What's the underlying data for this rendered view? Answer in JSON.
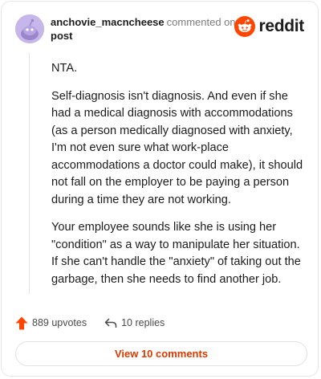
{
  "header": {
    "username": "anchovie_macncheese",
    "action": "commented on",
    "post_label": "post",
    "brand": "reddit"
  },
  "comment": {
    "paragraphs": [
      "NTA.",
      "Self-diagnosis isn't diagnosis. And even if she had a medical diagnosis with accommodations (as a person medically diagnosed with anxiety, I'm not even sure what work-place accommodations a doctor could make), it should not fall on the employer to be paying a person during a time they are not working.",
      "Your employee sounds like she is using her \"condition\" as a way to manipulate her situation. If she can't handle the \"anxiety\" of taking out the garbage, then she needs to find another job."
    ]
  },
  "footer": {
    "upvotes": "889 upvotes",
    "replies": "10 replies",
    "view_label": "View 10 comments"
  },
  "colors": {
    "accent": "#ff4500",
    "view_text": "#d93a00",
    "avatar_bg": "#c7b6ea"
  }
}
